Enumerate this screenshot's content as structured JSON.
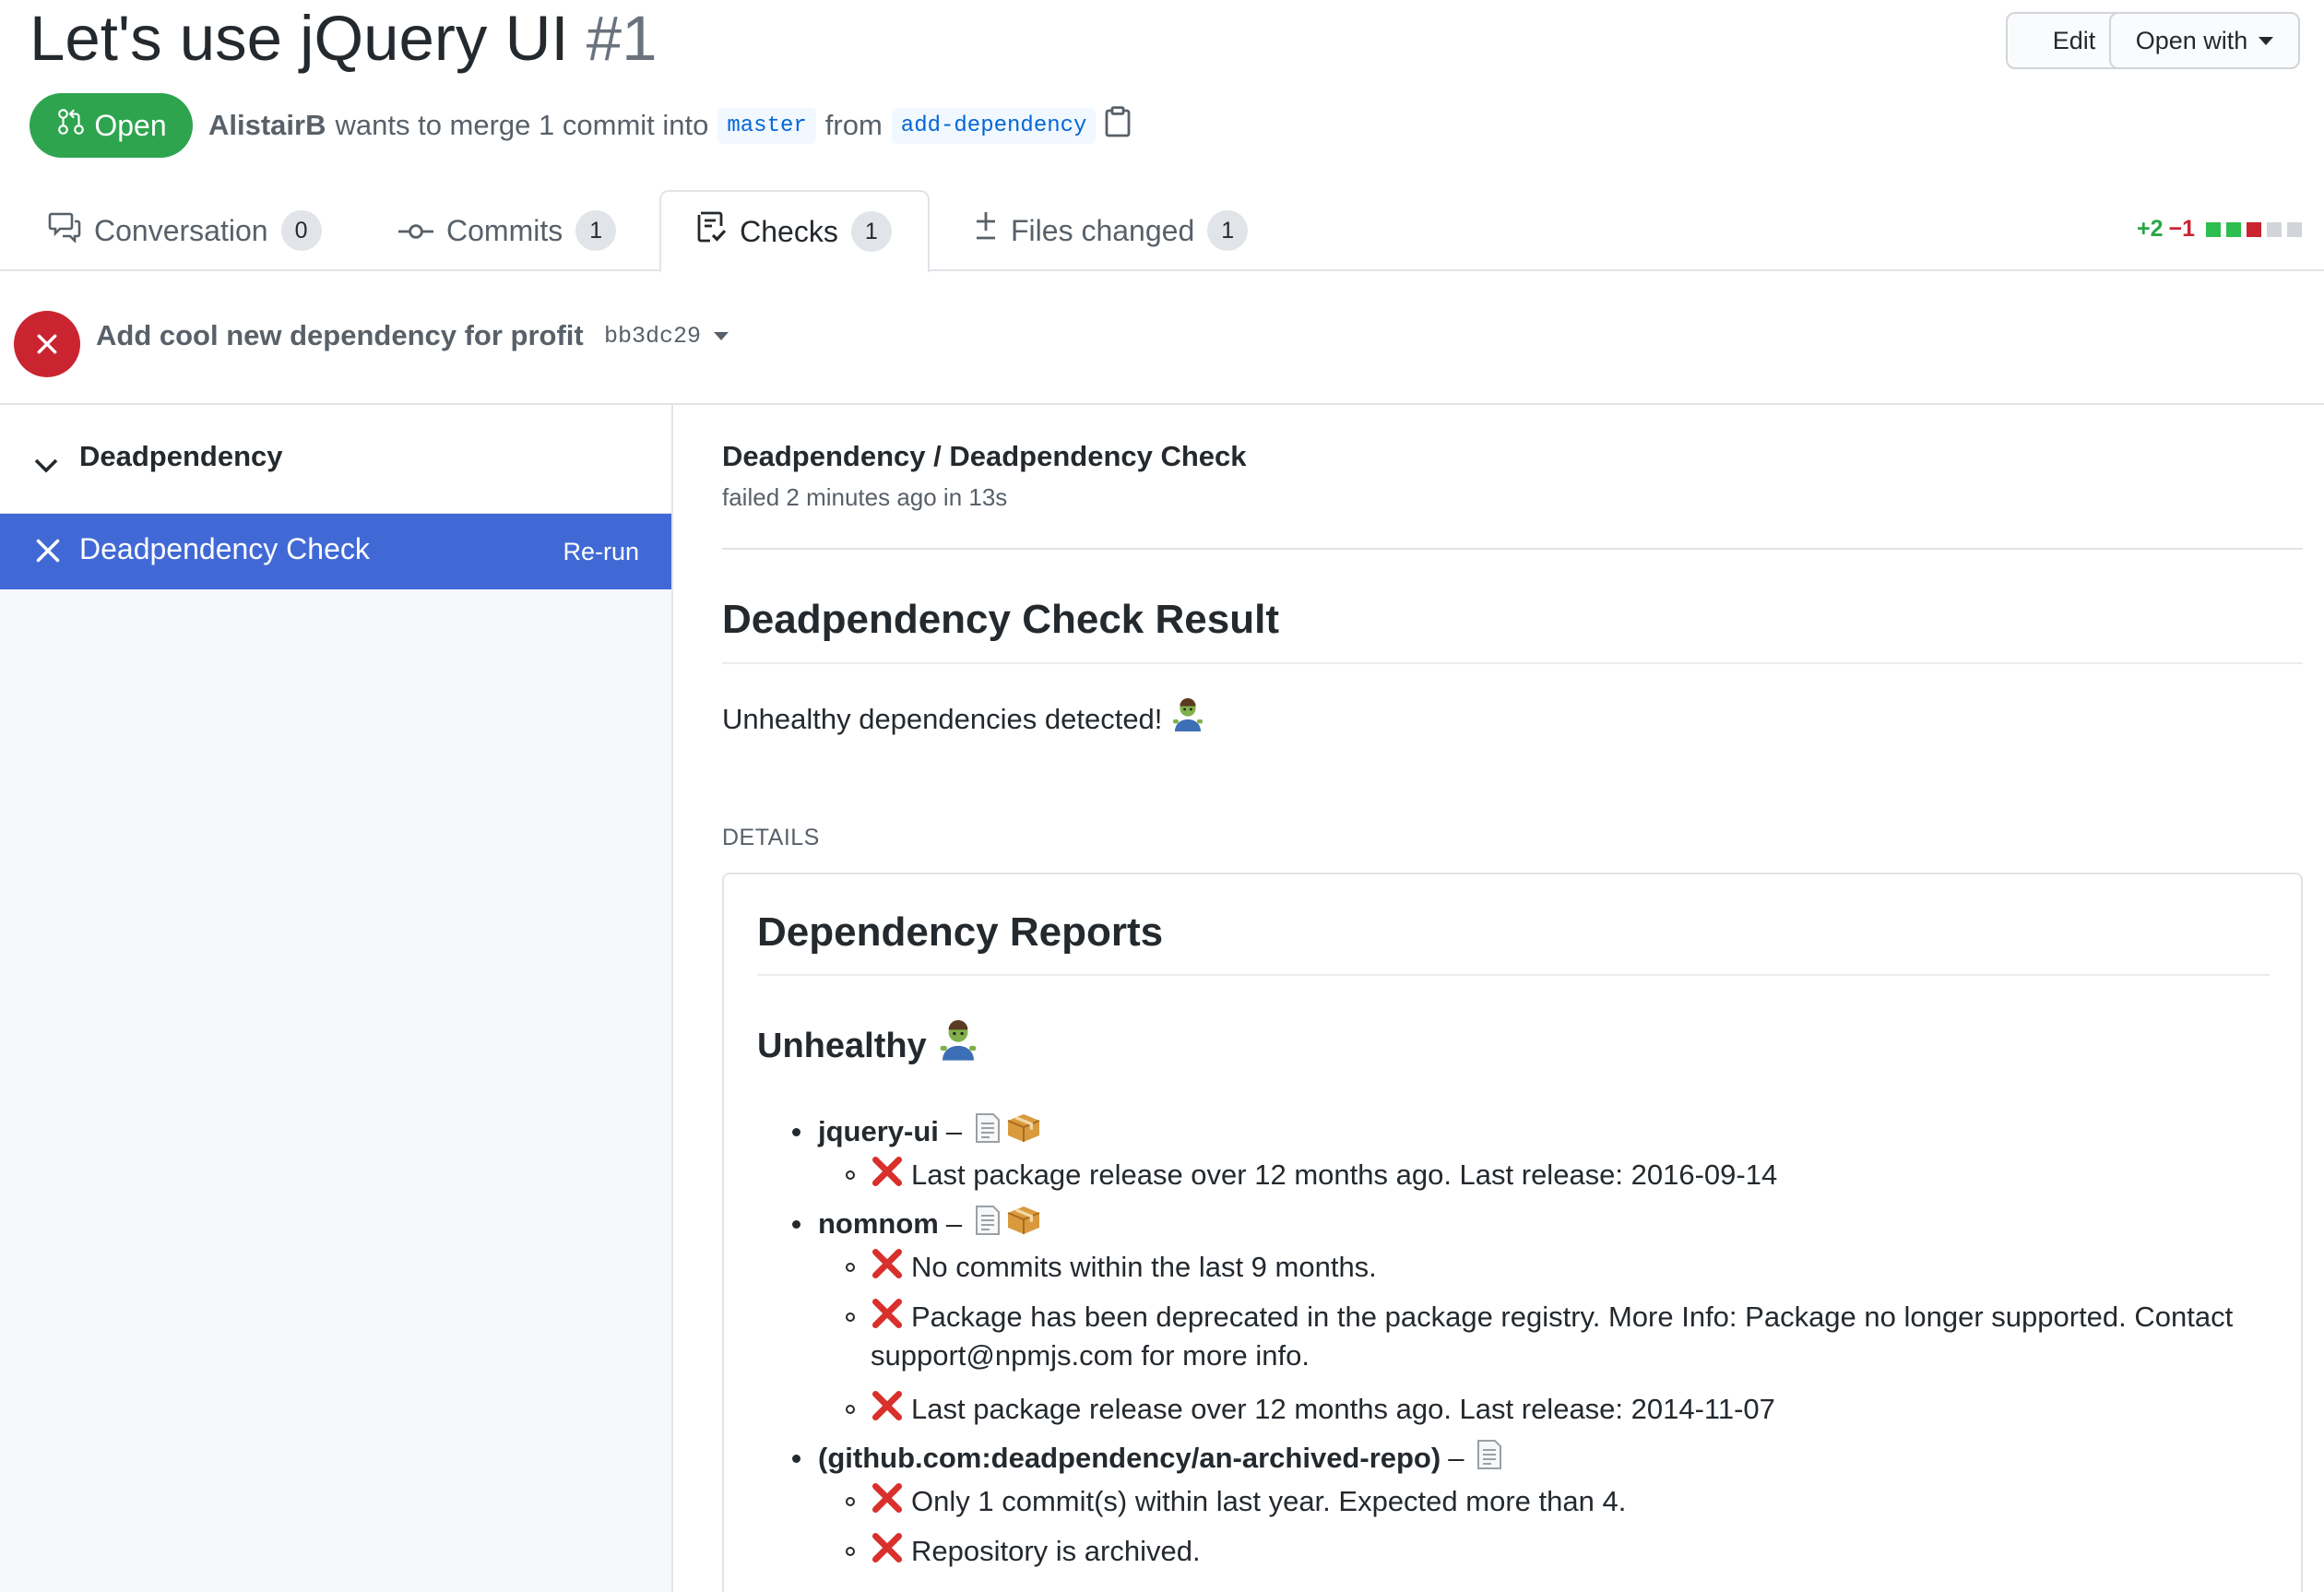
{
  "header": {
    "title": "Let's use jQuery UI",
    "number": "#1",
    "edit_label": "Edit",
    "open_with_label": "Open with"
  },
  "pr_meta": {
    "state": "Open",
    "author": "AlistairB",
    "merge_text": "wants to merge 1 commit into",
    "base_branch": "master",
    "from_text": "from",
    "head_branch": "add-dependency"
  },
  "tabs": [
    {
      "label": "Conversation",
      "count": "0"
    },
    {
      "label": "Commits",
      "count": "1"
    },
    {
      "label": "Checks",
      "count": "1"
    },
    {
      "label": "Files changed",
      "count": "1"
    }
  ],
  "diffstat": {
    "additions": "+2",
    "deletions": "−1"
  },
  "colors": {
    "green": "#2ea44f",
    "red": "#cb2431",
    "selected_run": "#4169d6"
  },
  "commit": {
    "message": "Add cool new dependency for profit",
    "sha": "bb3dc29"
  },
  "sidebar": {
    "suite_name": "Deadpendency",
    "run_name": "Deadpendency Check",
    "rerun_label": "Re-run"
  },
  "check": {
    "title": "Deadpendency / Deadpendency Check",
    "subtitle": "failed 2 minutes ago in 13s",
    "result_heading": "Deadpendency Check Result",
    "summary": "Unhealthy dependencies detected!",
    "details_label": "DETAILS"
  },
  "report": {
    "heading": "Dependency Reports",
    "unhealthy_heading": "Unhealthy",
    "packages": [
      {
        "name": "jquery-ui",
        "issues": [
          "Last package release over 12 months ago. Last release: 2016-09-14"
        ]
      },
      {
        "name": "nomnom",
        "issues": [
          "No commits within the last 9 months.",
          "Package has been deprecated in the package registry. More Info: Package no longer supported. Contact",
          "support@npmjs.com for more info.",
          "Last package release over 12 months ago. Last release: 2014-11-07"
        ]
      },
      {
        "name": "(github.com:deadpendency/an-archived-repo)",
        "issues": [
          "Only 1 commit(s) within last year. Expected more than 4.",
          "Repository is archived."
        ]
      }
    ]
  }
}
